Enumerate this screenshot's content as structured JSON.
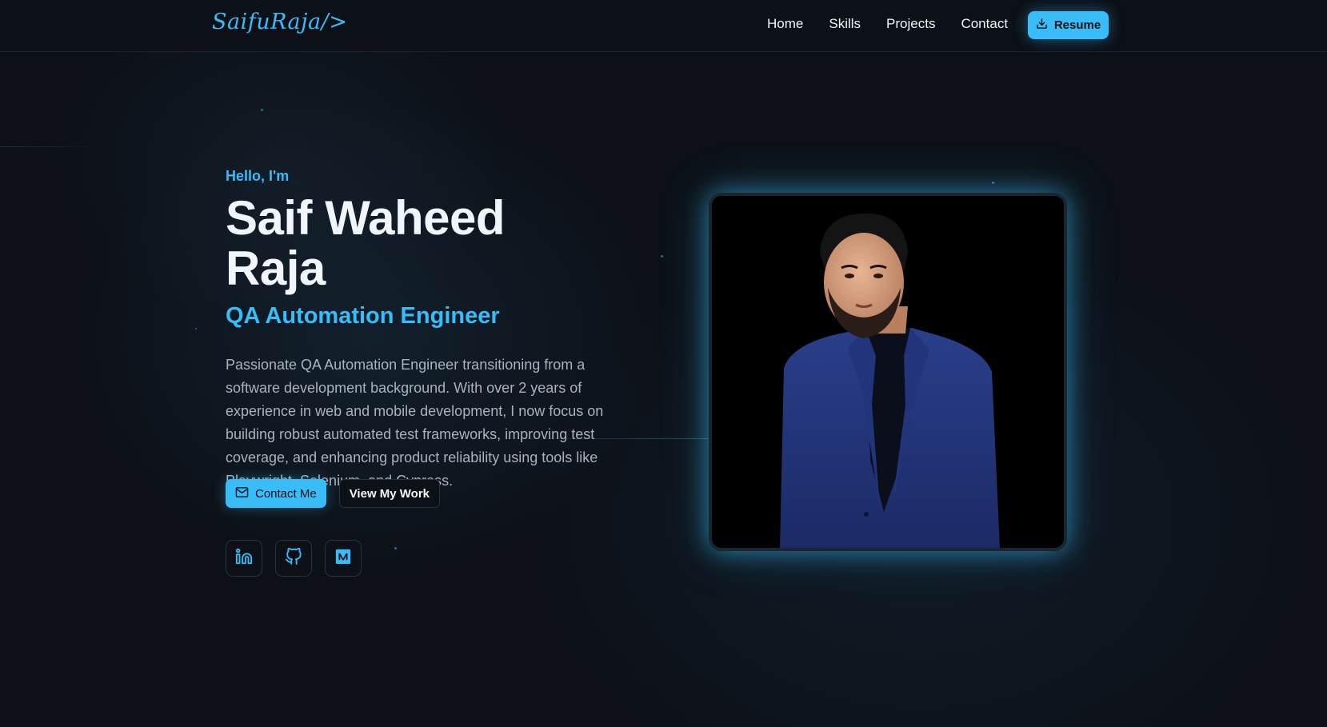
{
  "nav": {
    "logo": "SaifuRaja/>",
    "links": [
      "Home",
      "Skills",
      "Projects",
      "Contact"
    ],
    "resume_label": "Resume"
  },
  "hero": {
    "greeting": "Hello, I'm",
    "name": "Saif Waheed Raja",
    "role": "QA Automation Engineer",
    "bio": "Passionate QA Automation Engineer transitioning from a software development background. With over 2 years of experience in web and mobile development, I now focus on building robust automated test frameworks, improving test coverage, and enhancing product reliability using tools like Playwright, Selenium, and Cypress.",
    "contact_label": "Contact Me",
    "work_label": "View My Work"
  },
  "social": {
    "icons": [
      "linkedin-icon",
      "github-icon",
      "medium-icon"
    ]
  },
  "colors": {
    "accent": "#38bdf8",
    "background": "#0d1117",
    "text": "#f0f6fc",
    "muted": "#a8b3bf"
  }
}
